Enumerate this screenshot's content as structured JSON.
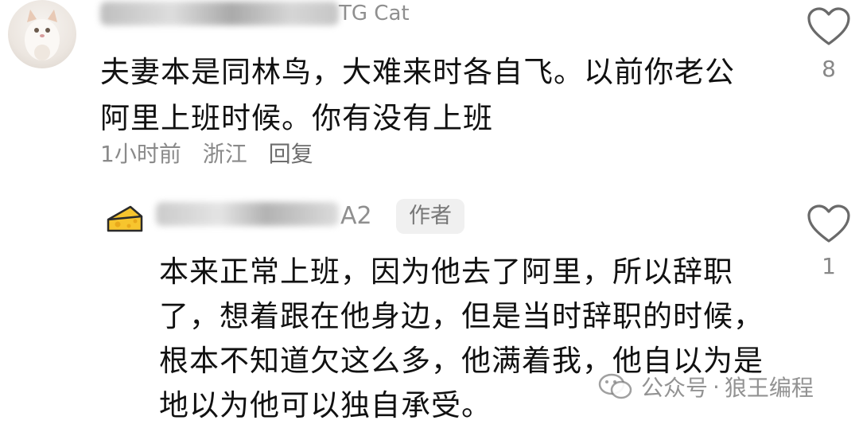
{
  "comment": {
    "username_visible": "TG Cat",
    "text": "夫妻本是同林鸟，大难来时各自飞。以前你老公阿里上班时候。你有没有上班",
    "meta": {
      "time": "1小时前",
      "location": "浙江",
      "reply_label": "回复"
    },
    "likes": "8",
    "avatar_icon": "cat-avatar-icon",
    "like_icon": "heart-outline-icon"
  },
  "reply": {
    "username_visible": "A2",
    "author_badge": "作者",
    "text": "本来正常上班，因为他去了阿里，所以辞职了，想着跟在他身边，但是当时辞职的时候，根本不知道欠这么多，他满着我，他自以为是地以为他可以独自承受。",
    "likes": "1",
    "avatar_icon": "cheese-avatar-icon",
    "like_icon": "heart-outline-icon"
  },
  "watermark": {
    "text": "公众号",
    "separator": "·",
    "account": "狼王编程",
    "icon": "wechat-icon"
  },
  "colors": {
    "text_primary": "#111111",
    "text_secondary": "#8a8a8a",
    "badge_bg": "#f0f0f0"
  }
}
